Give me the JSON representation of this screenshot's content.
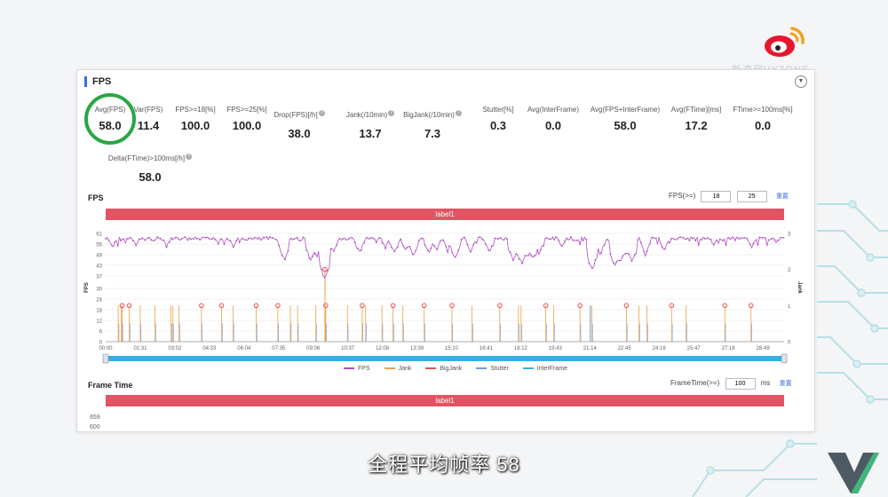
{
  "watermark": "新浪网VYZONE",
  "panel": {
    "title": "FPS"
  },
  "metrics": [
    {
      "label": "Avg(FPS)",
      "value": "58.0",
      "help": false
    },
    {
      "label": "Var(FPS)",
      "value": "11.4",
      "help": false
    },
    {
      "label": "FPS>=18[%]",
      "value": "100.0",
      "help": false
    },
    {
      "label": "FPS>=25[%]",
      "value": "100.0",
      "help": false
    },
    {
      "label": "Drop(FPS)[/h]",
      "value": "38.0",
      "help": true
    },
    {
      "label": "Jank(/10min)",
      "value": "13.7",
      "help": true
    },
    {
      "label": "BigJank(/10min)",
      "value": "7.3",
      "help": true
    },
    {
      "label": "Stutter[%]",
      "value": "0.3",
      "help": false
    },
    {
      "label": "Avg(InterFrame)",
      "value": "0.0",
      "help": false
    },
    {
      "label": "Avg(FPS+InterFrame)",
      "value": "58.0",
      "help": false
    },
    {
      "label": "Avg(FTime)[ms]",
      "value": "17.2",
      "help": false
    },
    {
      "label": "FTime>=100ms[%]",
      "value": "0.0",
      "help": false
    },
    {
      "label": "Delta(FTime)>100ms[/h]",
      "value": "58.0",
      "help": true
    }
  ],
  "fps_section": {
    "title": "FPS",
    "threshold_label": "FPS(>=)",
    "threshold1": "18",
    "threshold2": "25",
    "reset": "重置",
    "label_bar": "label1"
  },
  "frametime_section": {
    "title": "Frame Time",
    "threshold_label": "FrameTime(>=)",
    "threshold": "100",
    "unit": "ms",
    "reset": "重置",
    "label_bar": "label1",
    "y_ticks": [
      "659",
      "600"
    ]
  },
  "subtitle": "全程平均帧率 58",
  "chart_data": {
    "type": "line",
    "title": "FPS",
    "ylabel": "FPS",
    "y2label": "Jank",
    "ylim": [
      0,
      61
    ],
    "y2lim": [
      0,
      3
    ],
    "yticks": [
      0,
      6,
      12,
      18,
      24,
      30,
      37,
      43,
      49,
      55,
      61
    ],
    "y2ticks": [
      0,
      1,
      2,
      3
    ],
    "xticks": [
      "00:00",
      "01:31",
      "03:02",
      "04:33",
      "06:04",
      "07:35",
      "09:06",
      "10:37",
      "12:08",
      "13:39",
      "15:10",
      "16:41",
      "18:12",
      "19:43",
      "21:14",
      "22:45",
      "24:16",
      "25:47",
      "27:18",
      "28:49"
    ],
    "x_range_min": [
      0,
      1785
    ],
    "grid": true,
    "legend": "bottom",
    "legend_entries": [
      "FPS",
      "Jank",
      "BigJank",
      "Stutter",
      "InterFrame"
    ],
    "colors": {
      "FPS": "#b04fc4",
      "Jank": "#f0a040",
      "BigJank": "#e0535a",
      "Stutter": "#6f9be0",
      "InterFrame": "#35b0e6"
    },
    "series": [
      {
        "name": "FPS",
        "baseline": 59,
        "avg": 58.0,
        "dips": [
          [
            18,
            52
          ],
          [
            80,
            53
          ],
          [
            160,
            52
          ],
          [
            335,
            52
          ],
          [
            462,
            51
          ],
          [
            470,
            45
          ],
          [
            540,
            45
          ],
          [
            555,
            47
          ],
          [
            572,
            48
          ],
          [
            576,
            35
          ],
          [
            583,
            47
          ],
          [
            600,
            50
          ],
          [
            668,
            49
          ],
          [
            735,
            52
          ],
          [
            760,
            49
          ],
          [
            790,
            50
          ],
          [
            810,
            47
          ],
          [
            850,
            49
          ],
          [
            870,
            50
          ],
          [
            900,
            50
          ],
          [
            920,
            46
          ],
          [
            960,
            50
          ],
          [
            1010,
            49
          ],
          [
            1072,
            45
          ],
          [
            1080,
            48
          ],
          [
            1095,
            43
          ],
          [
            1110,
            47
          ],
          [
            1125,
            45
          ],
          [
            1140,
            49
          ],
          [
            1200,
            52
          ],
          [
            1280,
            40
          ],
          [
            1300,
            48
          ],
          [
            1340,
            42
          ],
          [
            1355,
            44
          ],
          [
            1370,
            47
          ],
          [
            1385,
            44
          ],
          [
            1420,
            48
          ],
          [
            1470,
            50
          ],
          [
            1600,
            53
          ],
          [
            1700,
            52
          ]
        ]
      },
      {
        "name": "Jank",
        "events_min": [
          33,
          41,
          43,
          62,
          91,
          130,
          172,
          177,
          193,
          252,
          305,
          335,
          396,
          453,
          486,
          505,
          553,
          579,
          636,
          675,
          684,
          727,
          756,
          782,
          838,
          911,
          964,
          1037,
          1086,
          1093,
          1158,
          1179,
          1248,
          1279,
          1370,
          1403,
          1424,
          1489,
          1527,
          1629,
          1698
        ],
        "values": 1
      },
      {
        "name": "BigJank",
        "events_min": [
          43,
          62,
          252,
          305,
          396,
          453,
          579,
          675,
          756,
          838,
          911,
          1037,
          1158,
          1248,
          1370,
          1489,
          1629,
          1698
        ],
        "values": 1
      },
      {
        "name": "Stutter",
        "events_min": [
          1275
        ],
        "values": 1
      }
    ],
    "big_event_min": 577,
    "big_event_value": 2
  }
}
